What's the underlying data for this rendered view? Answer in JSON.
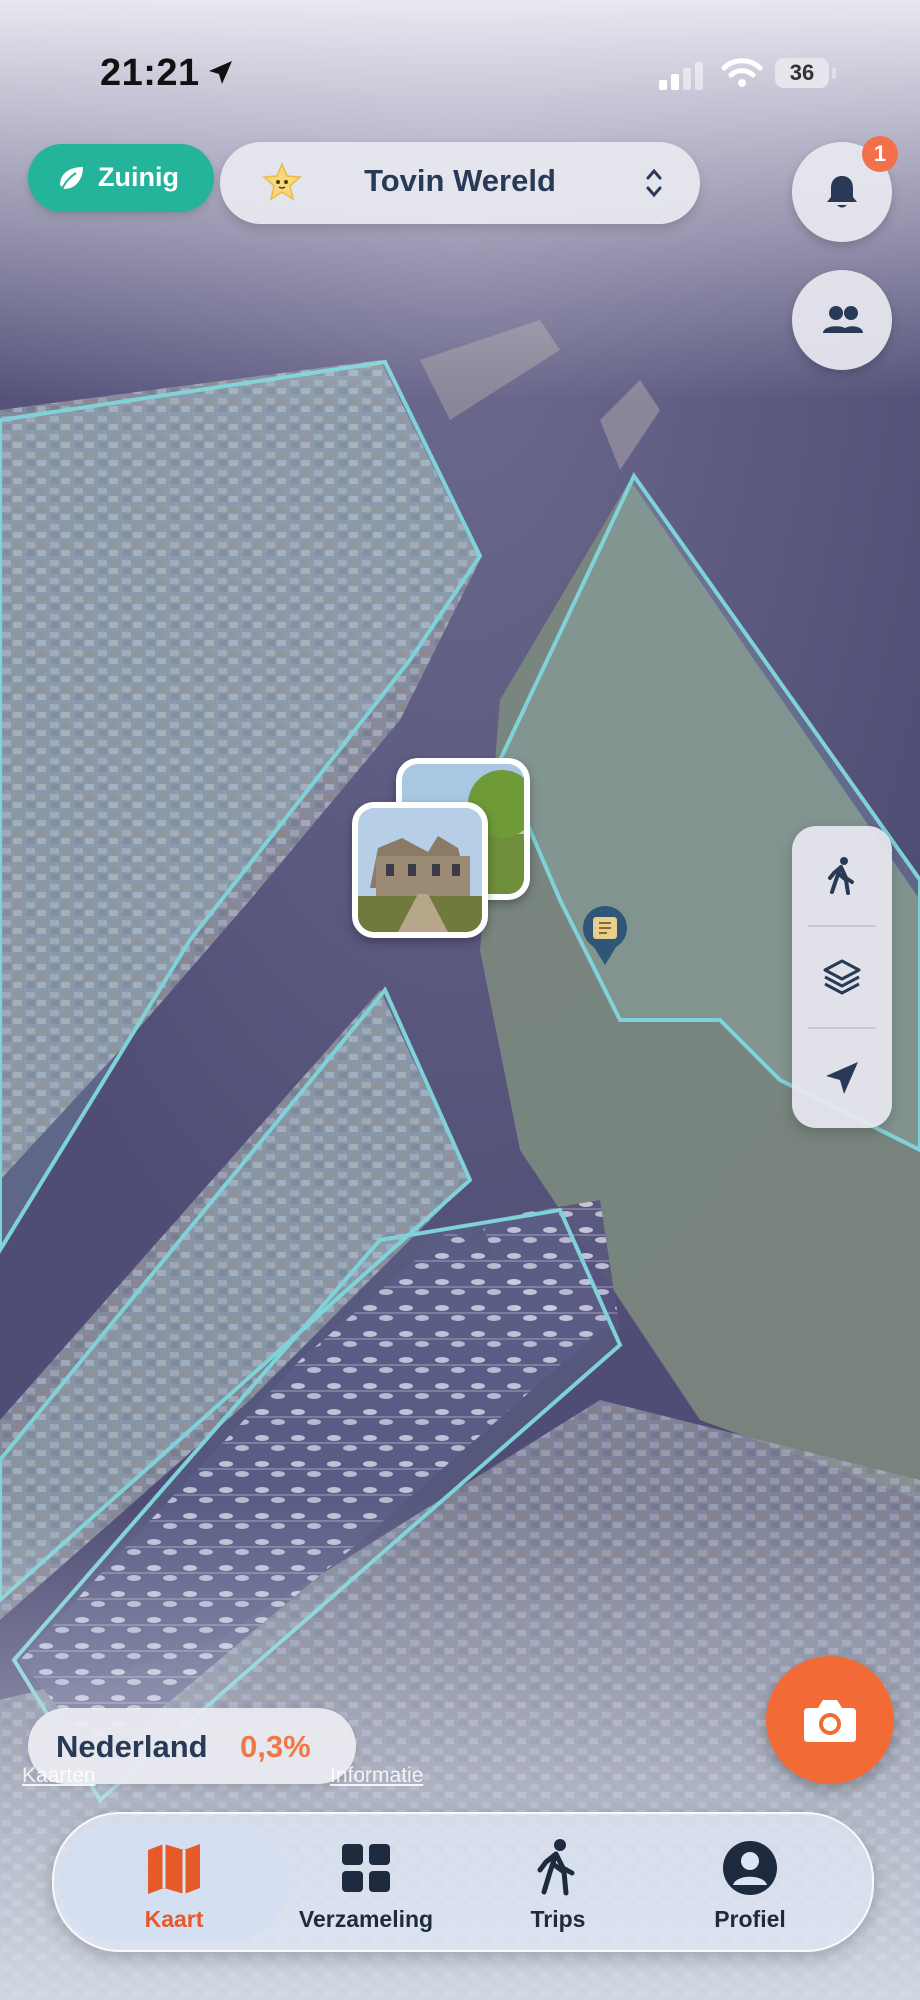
{
  "status_bar": {
    "time": "21:21",
    "battery": "36"
  },
  "top": {
    "mode_label": "Zuinig",
    "world_label": "Tovin Wereld",
    "notification_count": "1"
  },
  "map_icons": {
    "location_arrow": "location-arrow-icon",
    "pin": "scroll-pin-icon"
  },
  "country": {
    "name": "Nederland",
    "percentage": "0,3%"
  },
  "attribution": {
    "left": "Kaarten",
    "right": "Informatie"
  },
  "nav": {
    "items": [
      {
        "label": "Kaart",
        "icon": "map-icon",
        "active": true
      },
      {
        "label": "Verzameling",
        "icon": "grid-icon",
        "active": false
      },
      {
        "label": "Trips",
        "icon": "walking-icon",
        "active": false
      },
      {
        "label": "Profiel",
        "icon": "profile-icon",
        "active": false
      }
    ]
  },
  "colors": {
    "accent_green": "#24b39b",
    "accent_orange": "#f26a35",
    "badge": "#f2704a",
    "text_dark": "#283a55",
    "zone_outline": "#7fd3d8"
  }
}
